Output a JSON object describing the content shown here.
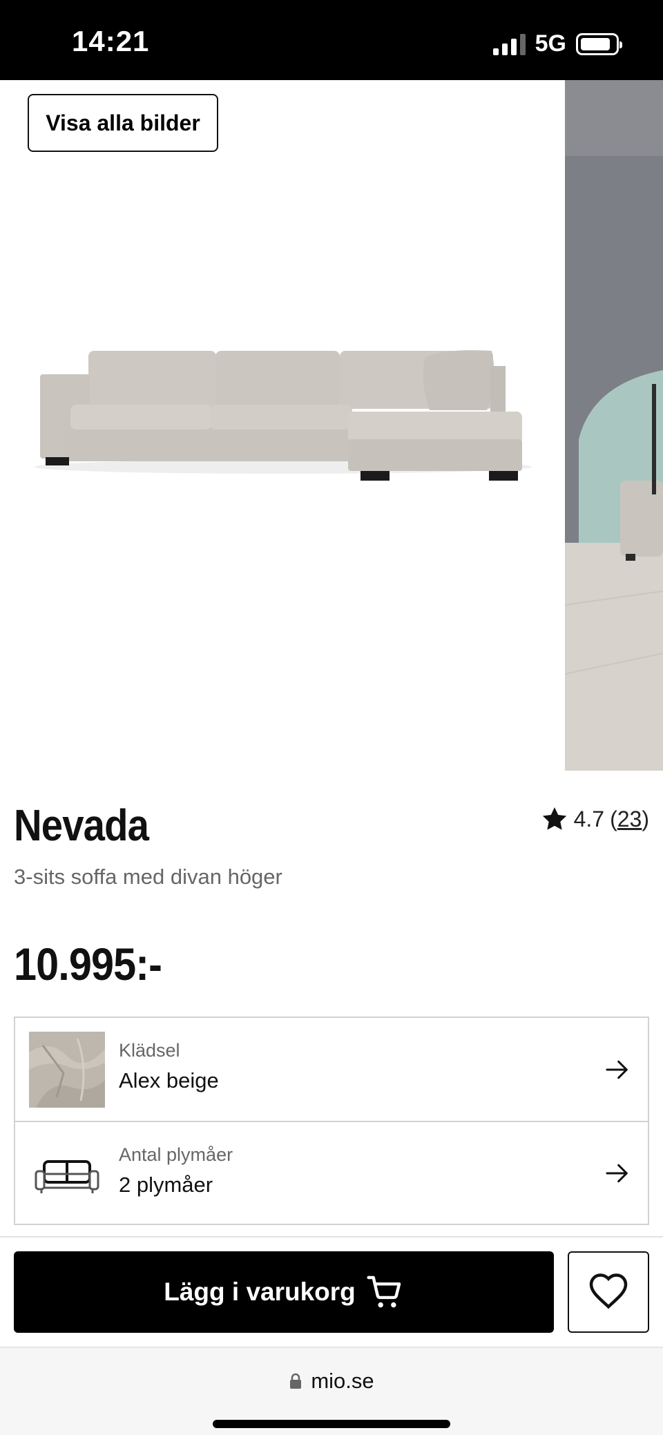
{
  "status_bar": {
    "time": "14:21",
    "network": "5G",
    "signal_bars": 3
  },
  "gallery": {
    "view_all_label": "Visa alla bilder"
  },
  "product": {
    "title": "Nevada",
    "subtitle": "3-sits soffa med divan höger",
    "price": "10.995:-",
    "rating": {
      "value": "4.7",
      "open_paren": "(",
      "count": "23",
      "close_paren": ")"
    }
  },
  "options": [
    {
      "label": "Klädsel",
      "value": "Alex beige",
      "icon": "fabric-swatch-icon"
    },
    {
      "label": "Antal plymåer",
      "value": "2 plymåer",
      "icon": "sofa-icon"
    }
  ],
  "actions": {
    "add_to_cart_label": "Lägg i varukorg",
    "cart_icon": "cart-icon",
    "wishlist_icon": "heart-icon"
  },
  "browser": {
    "url": "mio.se",
    "lock_icon": "lock-icon"
  },
  "colors": {
    "black": "#000000",
    "sofa": "#cfcbc4",
    "wall": "#7d7f86",
    "arch": "#a9c7c0"
  }
}
